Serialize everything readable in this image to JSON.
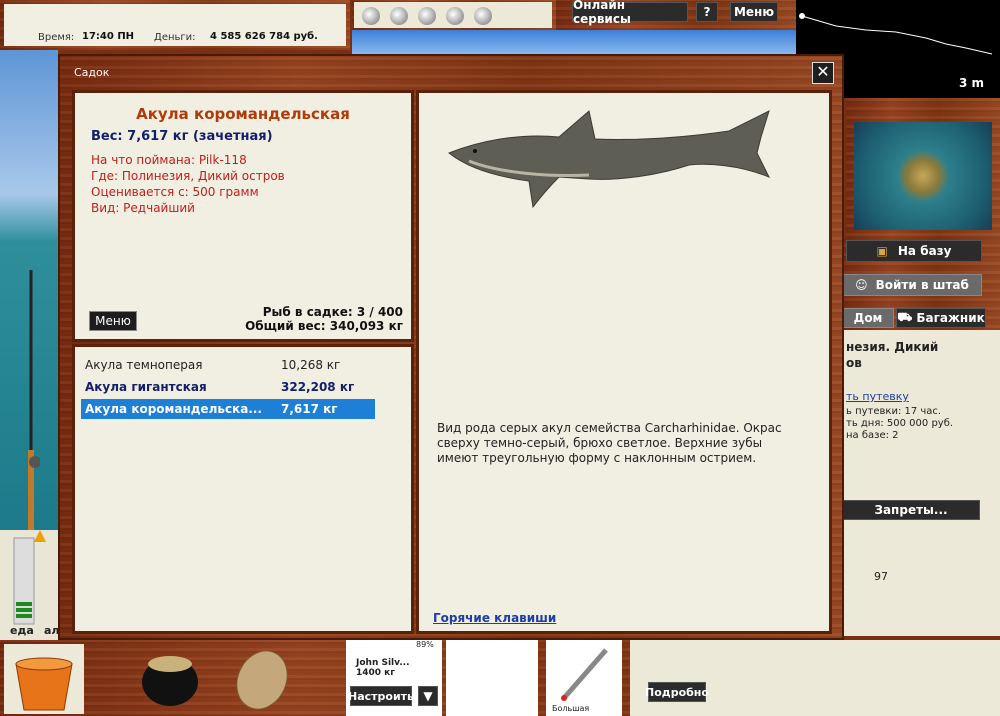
{
  "top": {
    "time_label": "Время:",
    "time_value": "17:40 ПН",
    "money_label": "Деньги:",
    "money_value": "4 585 626 784 руб.",
    "online_services": "Онлайн сервисы",
    "help": "?",
    "menu": "Меню",
    "depth": "3 m"
  },
  "right": {
    "to_base": "На базу",
    "to_hq": "Войти в штаб",
    "home": "Дом",
    "trunk": "Багажник",
    "location_title_1": "незия. Дикий",
    "location_title_2": "ов",
    "voucher_link": "ть путевку",
    "voucher_time": "ь путевки: 17 час.",
    "voucher_day_price": "ть дня: 500 000 руб.",
    "on_base": "на базе: 2",
    "bans": "Запреты...",
    "number": "97"
  },
  "bottom": {
    "food_label": "еда",
    "food_label_2": "ал",
    "reel_name": "John Silv...",
    "reel_weight": "1400 кг",
    "reel_percent": "89%",
    "configure": "Настроить",
    "lure_label": "Большая",
    "details": "Подробно"
  },
  "modal": {
    "title": "Садок",
    "close": "✕",
    "fish": {
      "name": "Акула коромандельская",
      "weight": "Вес: 7,617 кг (зачетная)",
      "caught_on": "На что поймана: Pilk-118",
      "where": "Где: Полинезия, Дикий остров",
      "valued_from": "Оценивается с: 500 грамм",
      "kind": "Вид: Редчайший"
    },
    "menu_button": "Меню",
    "fish_in_keepnet": "Рыб в садке: 3 / 400",
    "total_weight": "Общий вес: 340,093 кг",
    "list": [
      {
        "name": "Акула темноперая",
        "weight": "10,268 кг"
      },
      {
        "name": "Акула гигантская",
        "weight": "322,208 кг"
      },
      {
        "name": "Акула коромандельска...",
        "weight": "7,617 кг"
      }
    ],
    "description": "Вид рода серых акул семейства Carcharhinidae. Окрас сверху темно-серый, брюхо светлое. Верхние зубы имеют треугольную форму с наклонным острием.",
    "hotkeys": "Горячие клавиши"
  },
  "colors": {
    "accent_title": "#b13a0a",
    "weight_blue": "#12206b",
    "prop_red": "#c0201a",
    "selection": "#1e7fd6",
    "wood": "#8a3817"
  }
}
